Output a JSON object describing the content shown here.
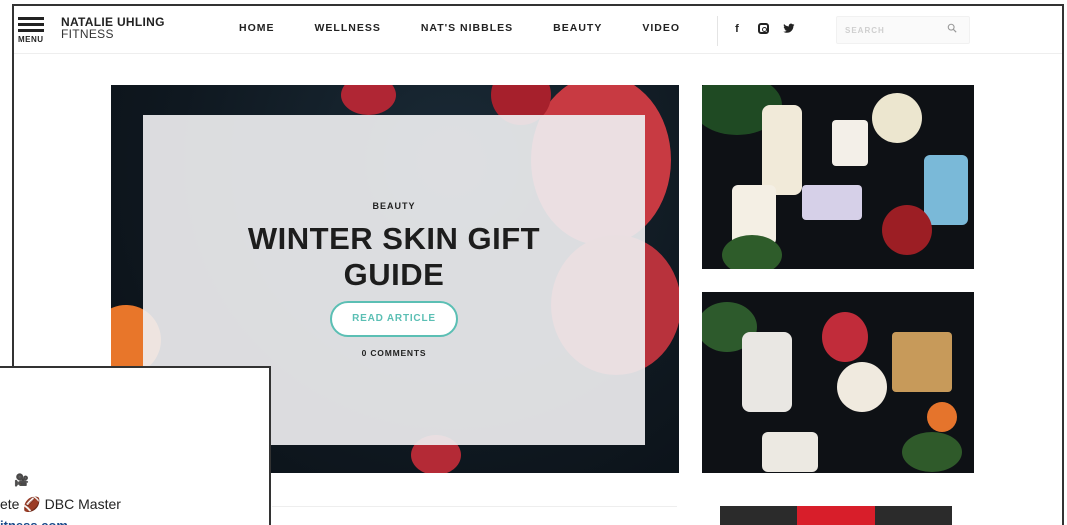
{
  "header": {
    "menu_label": "MENU",
    "logo_line1": "NATALIE UHLING",
    "logo_line2": "FITNESS",
    "nav": [
      "HOME",
      "WELLNESS",
      "NAT'S NIBBLES",
      "BEAUTY",
      "VIDEO"
    ],
    "social": [
      "facebook-icon",
      "instagram-icon",
      "twitter-icon"
    ],
    "search_placeholder": "SEARCH"
  },
  "hero": {
    "category": "BEAUTY",
    "title": "WINTER SKIN GIFT GUIDE",
    "button_label": "READ ARTICLE",
    "comments": "0 COMMENTS",
    "accent_color": "#5bbfb4"
  },
  "overlay_profile": {
    "icon": "🎥",
    "text": "ete 🏈 DBC Master",
    "link": "itness.com"
  }
}
